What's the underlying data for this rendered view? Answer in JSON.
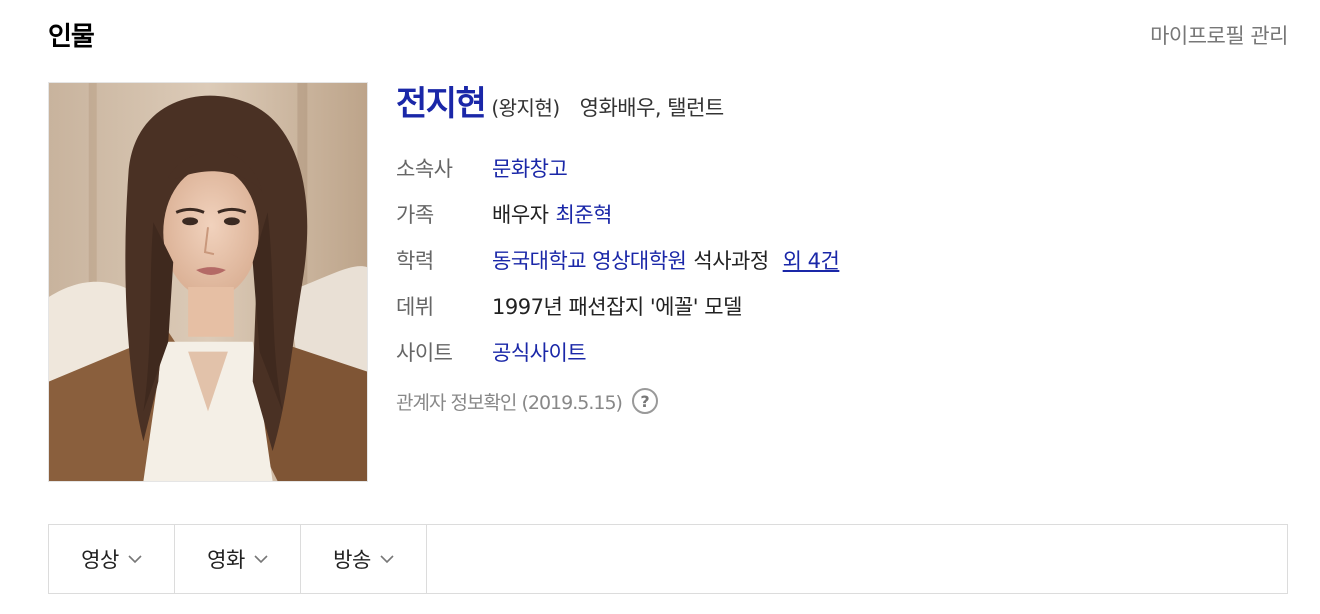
{
  "header": {
    "title": "인물",
    "manage_label": "마이프로필 관리"
  },
  "profile": {
    "name": "전지현",
    "original_name": "(왕지현)",
    "job": "영화배우, 탤런트",
    "agency": {
      "label": "소속사",
      "value": "문화창고"
    },
    "family": {
      "label": "가족",
      "relation": "배우자",
      "name": "최준혁"
    },
    "education": {
      "label": "학력",
      "school": "동국대학교 영상대학원",
      "course": "석사과정",
      "more": "외 4건"
    },
    "debut": {
      "label": "데뷔",
      "value": "1997년 패션잡지 '에꼴' 모델"
    },
    "site": {
      "label": "사이트",
      "value": "공식사이트"
    },
    "confirmed": "관계자 정보확인 (2019.5.15)",
    "help_icon": "?"
  },
  "tabs": [
    {
      "label": "영상",
      "icon": "chevron-down-icon"
    },
    {
      "label": "영화",
      "icon": "chevron-down-icon"
    },
    {
      "label": "방송",
      "icon": "chevron-down-icon"
    }
  ],
  "colors": {
    "link": "#1a27a8",
    "label": "#666666",
    "muted": "#888888",
    "border": "#dcdcdc"
  }
}
